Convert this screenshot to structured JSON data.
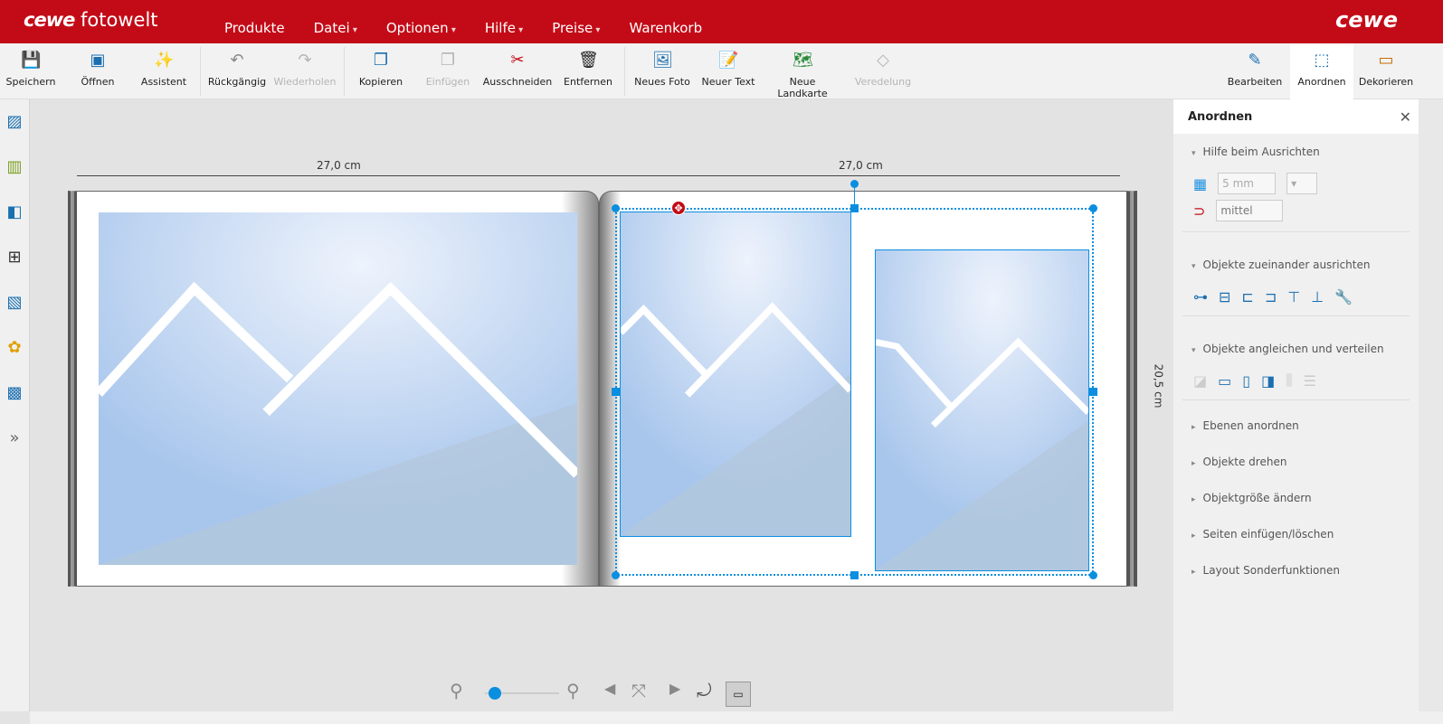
{
  "header": {
    "logo_brand": "cewe",
    "logo_text": "fotowelt",
    "logo_right": "cewe",
    "menu": [
      "Produkte",
      "Datei",
      "Optionen",
      "Hilfe",
      "Preise",
      "Warenkorb"
    ]
  },
  "toolbar": {
    "items": [
      "Speichern",
      "Öffnen",
      "Assistent",
      "Rückgängig",
      "Wiederholen",
      "Kopieren",
      "Einfügen",
      "Ausschneiden",
      "Entfernen",
      "Neues Foto",
      "Neuer Text",
      "Neue Landkarte",
      "Veredelung"
    ],
    "modes": [
      "Bearbeiten",
      "Anordnen",
      "Dekorieren"
    ]
  },
  "canvas": {
    "width_left": "27,0 cm",
    "width_right": "27,0 cm",
    "height": "20,5 cm"
  },
  "panel": {
    "title": "Anordnen",
    "sections": [
      "Hilfe beim Ausrichten",
      "Objekte zueinander ausrichten",
      "Objekte angleichen und verteilen",
      "Ebenen anordnen",
      "Objekte drehen",
      "Objektgröße ändern",
      "Seiten einfügen/löschen",
      "Layout Sonderfunktionen"
    ],
    "grid_value": "5 mm",
    "snap_value": "mittel"
  },
  "zoom": {
    "level": 0.05
  }
}
